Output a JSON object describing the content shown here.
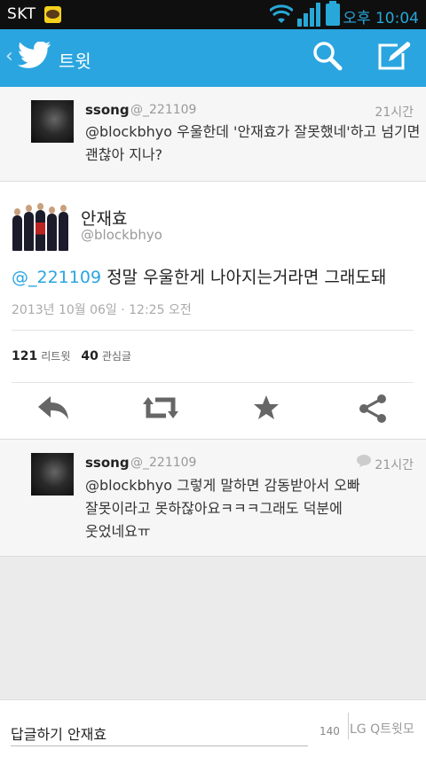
{
  "status_bar": {
    "carrier": "SKT",
    "clock": "오후 10:04"
  },
  "header": {
    "title": "트윗"
  },
  "reply_above": {
    "name": "ssong",
    "handle": "@_221109",
    "time": "21시간",
    "text_line1": "@blockbhyo 우울한데 '안재효가 잘못했네'하고 넘기면",
    "text_line2": "괜찮아 지나?"
  },
  "main_tweet": {
    "name": "안재효",
    "handle": "@blockbhyo",
    "mention": "@_221109",
    "text": " 정말 우울한게 나아지는거라면 그래도돼",
    "date": "2013년 10월 06일 · 12:25 오전",
    "retweet_count": "121",
    "retweet_label": "리트윗",
    "favorite_count": "40",
    "favorite_label": "관심글"
  },
  "reply_below": {
    "name": "ssong",
    "handle": "@_221109",
    "time": "21시간",
    "text_line1": "@blockbhyo 그렇게 말하면 감동받아서 오빠",
    "text_line2": "잘못이라고 못하잖아요ㅋㅋㅋ그래도 덕분에",
    "text_line3": "웃었네요ㅠ"
  },
  "composer": {
    "value": "답글하기 안재효",
    "char_count": "140",
    "send_label": "LG Q트윗모"
  },
  "colors": {
    "twitter_blue": "#2aa5e0",
    "status_accent": "#27a8d8"
  }
}
